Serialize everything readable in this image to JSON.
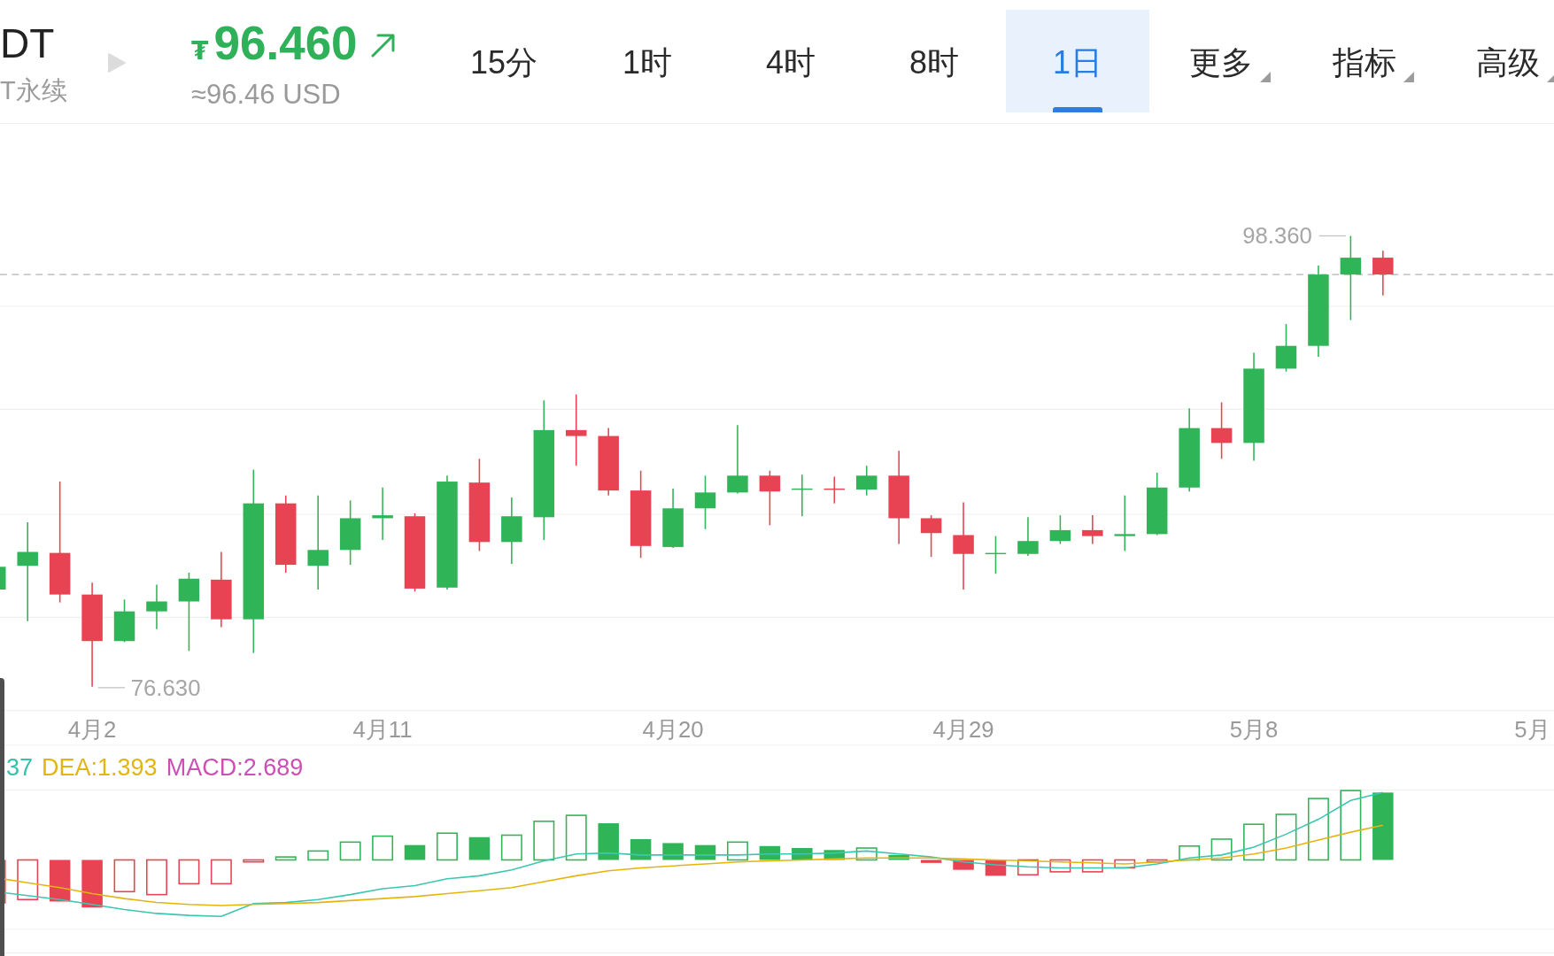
{
  "header": {
    "symbol": "DT",
    "contract": "T永续",
    "price": {
      "currency": "₮",
      "value": "96.460",
      "rising": true
    },
    "converted": "≈96.46 USD"
  },
  "intervals": [
    {
      "label": "15分",
      "kind": "interval",
      "selected": false
    },
    {
      "label": "1时",
      "kind": "interval",
      "selected": false
    },
    {
      "label": "4时",
      "kind": "interval",
      "selected": false
    },
    {
      "label": "8时",
      "kind": "interval",
      "selected": false
    },
    {
      "label": "1日",
      "kind": "interval",
      "selected": true
    },
    {
      "label": "更多",
      "kind": "menu",
      "selected": false
    },
    {
      "label": "指标",
      "kind": "menu",
      "selected": false
    },
    {
      "label": "高级",
      "kind": "menu",
      "selected": false
    }
  ],
  "price_chart": {
    "high_label": "98.360",
    "low_label": "76.630",
    "dates": [
      "4月2",
      "4月11",
      "4月20",
      "4月29",
      "5月8",
      "5月"
    ]
  },
  "macd": {
    "legend": [
      {
        "text": "37",
        "color": "#37c0aa"
      },
      {
        "text": "DEA:1.393",
        "color": "#e3b512"
      },
      {
        "text": "MACD:2.689",
        "color": "#cc4fb5"
      }
    ]
  }
}
